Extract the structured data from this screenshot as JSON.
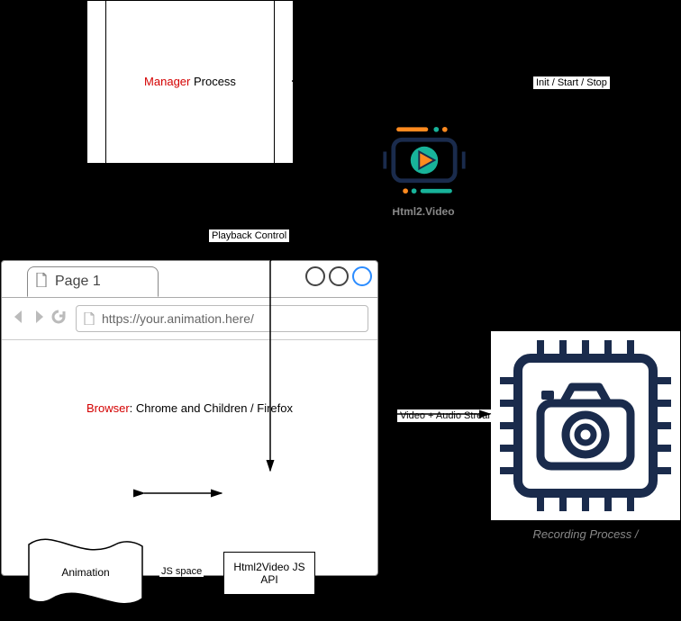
{
  "manager": {
    "mgr": "Manager",
    "proc": " Process"
  },
  "labels": {
    "init": "Init / Start / Stop",
    "playback": "Playback Control",
    "jsspace": "JS space",
    "vas": "Video + Audio Stream"
  },
  "h2v_title": "Html2.Video",
  "browser": {
    "tab": "Page 1",
    "url": "https://your.animation.here/",
    "br": "Browser",
    "rest": ": Chrome and Children /  Firefox"
  },
  "anim_label": "Animation",
  "api_label": "Html2Video JS API",
  "rec_label": "Recording Process /"
}
